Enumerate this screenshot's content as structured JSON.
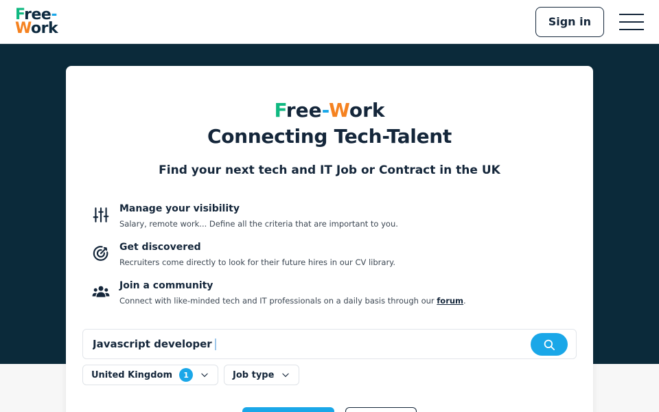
{
  "header": {
    "logo_line1": "Free-",
    "logo_line2": "Work",
    "signin_label": "Sign in"
  },
  "hero": {
    "brand_f": "F",
    "brand_ree": "ree",
    "brand_dash": "-",
    "brand_w": "W",
    "brand_ork": "ork",
    "tagline": "Connecting Tech-Talent",
    "subtitle": "Find your next tech and IT Job or Contract in the UK"
  },
  "features": [
    {
      "icon": "sliders-icon",
      "title": "Manage your visibility",
      "description": "Salary, remote work... Define all the criteria that are important to you."
    },
    {
      "icon": "target-icon",
      "title": "Get discovered",
      "description": "Recruiters come directly to look for their future hires in our CV library."
    },
    {
      "icon": "users-icon",
      "title": "Join a community",
      "description": "Connect with like-minded tech and IT professionals on a daily basis through our ",
      "link_text": "forum",
      "suffix": "."
    }
  ],
  "search": {
    "value": "Javascript developer"
  },
  "filters": {
    "location_label": "United Kingdom",
    "location_count": "1",
    "job_type_label": "Job type"
  },
  "colors": {
    "accent": "#1aa7e8",
    "green": "#10b981",
    "orange": "#f58220",
    "navy": "#0b2a3a",
    "text": "#14263a"
  }
}
